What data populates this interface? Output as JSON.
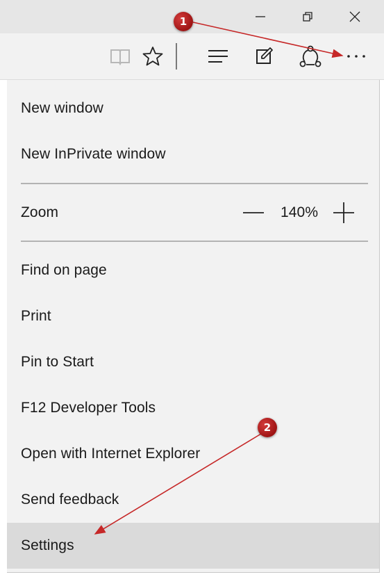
{
  "titlebar": {
    "buttons": [
      {
        "name": "minimize-icon",
        "glyph": "minimize"
      },
      {
        "name": "restore-icon",
        "glyph": "restore"
      },
      {
        "name": "close-icon",
        "glyph": "close"
      }
    ]
  },
  "toolbar": {
    "icons": [
      "reading-view-icon",
      "favorite-star-icon",
      "hub-icon",
      "web-note-icon",
      "share-icon",
      "more-actions-icon"
    ]
  },
  "menu": {
    "new_window": "New window",
    "new_inprivate_window": "New InPrivate window",
    "zoom_label": "Zoom",
    "zoom_value": "140%",
    "find_on_page": "Find on page",
    "print": "Print",
    "pin_to_start": "Pin to Start",
    "developer_tools": "F12 Developer Tools",
    "open_with_ie": "Open with Internet Explorer",
    "send_feedback": "Send feedback",
    "settings": "Settings"
  },
  "annotations": {
    "marker_1": "1",
    "marker_2": "2",
    "color": "#c62828"
  }
}
